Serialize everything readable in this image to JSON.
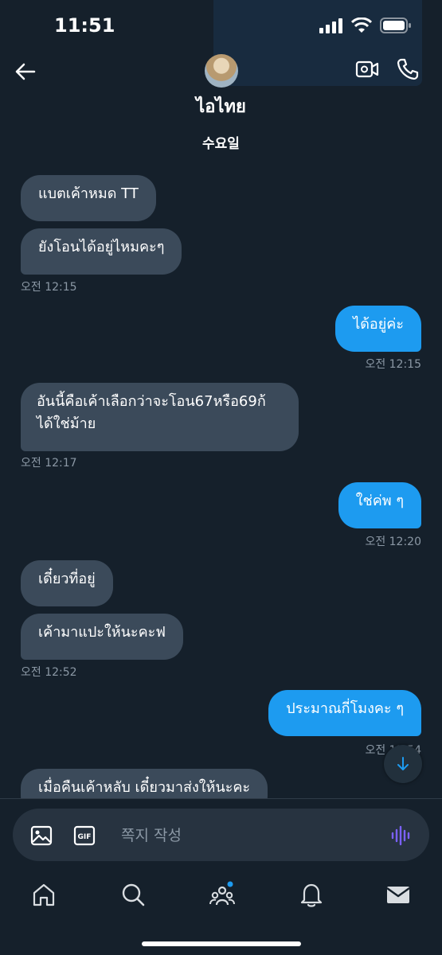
{
  "status_bar": {
    "time": "11:51"
  },
  "header": {
    "contact_name": "ไอไทย"
  },
  "day_divider": "수요일",
  "messages": [
    {
      "text": "แบตเค้าหมด TT",
      "direction": "in"
    },
    {
      "text": "ยังโอนได้อยู่ไหมคะๆ",
      "direction": "in",
      "time": "오전 12:15"
    },
    {
      "text": "ได้อยู่ค่ะ",
      "direction": "out",
      "time": "오전 12:15"
    },
    {
      "line1": "อันนี้คือเค้าเลือกว่าจะโอน67หรือ69ก้",
      "line2": "ได้ใช่ม้าย",
      "direction": "in",
      "time": "오전 12:17"
    },
    {
      "text": "ใช่ค่พ ๆ",
      "direction": "out",
      "time": "오전 12:20"
    },
    {
      "text": "เดี๋ยวที่อยู่",
      "direction": "in"
    },
    {
      "text": "เค้ามาแปะให้นะคะฟ",
      "direction": "in",
      "time": "오전 12:52"
    },
    {
      "text": "ประมาณกี่โมงคะ ๆ",
      "direction": "out",
      "time": "오전 12:54"
    },
    {
      "text": "เมื่อคืนเค้าหลับ เดี๋ยวมาส่งให้นะคะ",
      "direction": "in"
    }
  ],
  "composer": {
    "placeholder": "쪽지 작성"
  },
  "colors": {
    "background": "#15202b",
    "incoming_bubble": "#3b4a5a",
    "outgoing_bubble": "#1d9bf0",
    "muted_text": "#8b98a5",
    "voice_icon": "#7b61ff",
    "notification_dot": "#1d9bf0"
  },
  "icons": {
    "back": "arrow-left-icon",
    "video": "video-camera-icon",
    "call": "phone-icon",
    "image": "image-icon",
    "gif": "gif-icon",
    "voice": "voice-waveform-icon",
    "scroll": "arrow-down-icon",
    "tabs": [
      "home-icon",
      "search-icon",
      "communities-icon",
      "bell-icon",
      "mail-icon"
    ]
  }
}
